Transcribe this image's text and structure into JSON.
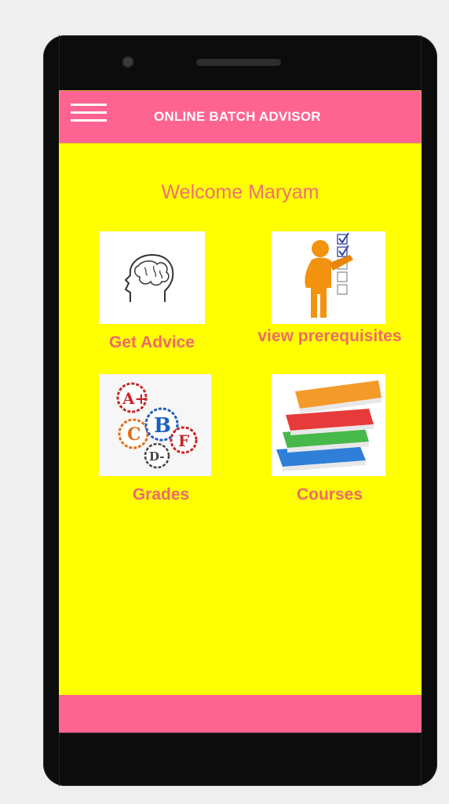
{
  "app": {
    "title": "ONLINE BATCH ADVISOR",
    "welcome": "Welcome Maryam"
  },
  "menu": {
    "icon": "hamburger-menu-icon"
  },
  "tiles": [
    {
      "label": "Get Advice",
      "icon": "brain-head-icon"
    },
    {
      "label": "view prerequisites",
      "icon": "checklist-person-icon"
    },
    {
      "label": "Grades",
      "icon": "grade-badges-icon"
    },
    {
      "label": "Courses",
      "icon": "books-stack-icon"
    }
  ],
  "colors": {
    "appbar": "#ff6392",
    "screen_bg": "#ffff00",
    "label_text": "#ee6a6a"
  }
}
